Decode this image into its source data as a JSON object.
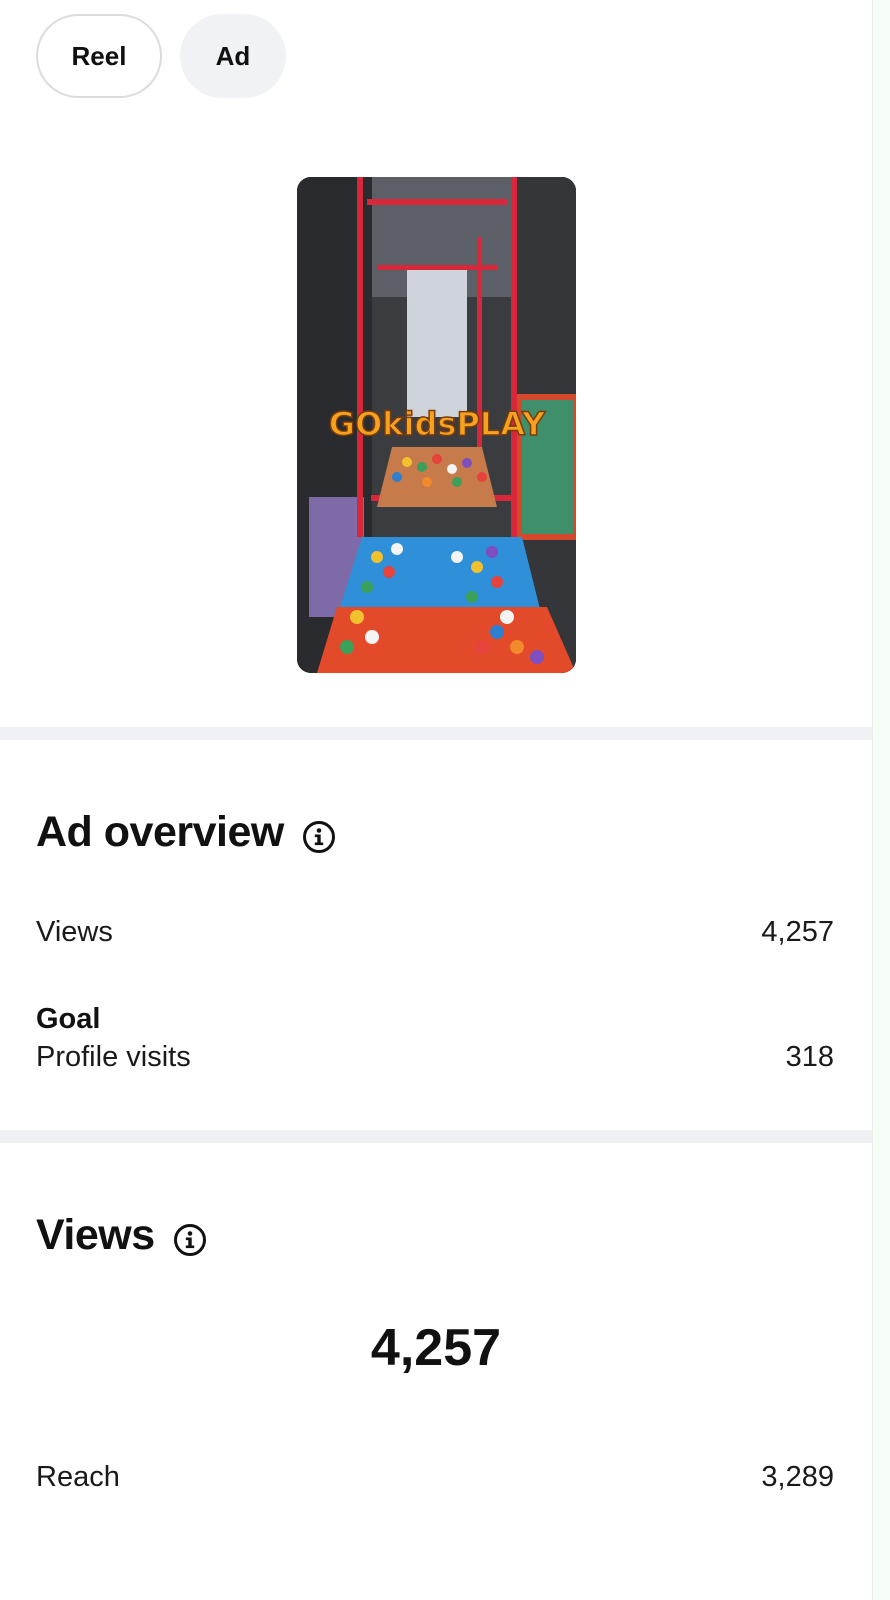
{
  "tabs": [
    {
      "label": "Reel"
    },
    {
      "label": "Ad"
    }
  ],
  "media": {
    "overlay_text": "GOkidsPLAY"
  },
  "ad_overview": {
    "title": "Ad overview",
    "info_icon": "info-circle-icon",
    "views_label": "Views",
    "views_value": "4,257",
    "goal_heading": "Goal",
    "goal_label": "Profile visits",
    "goal_value": "318"
  },
  "views_section": {
    "title": "Views",
    "info_icon": "info-circle-icon",
    "total": "4,257",
    "reach_label": "Reach",
    "reach_value": "3,289"
  },
  "colors": {
    "divider": "#eef0f3",
    "pill_active_bg": "#f0f2f5",
    "pill_border": "#dcdcdc",
    "text": "#111111"
  }
}
